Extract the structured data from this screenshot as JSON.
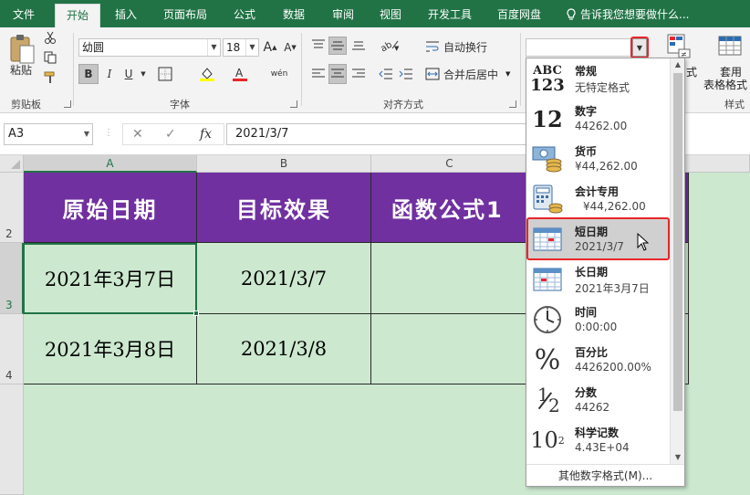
{
  "tabs": [
    "文件",
    "开始",
    "插入",
    "页面布局",
    "公式",
    "数据",
    "审阅",
    "视图",
    "开发工具",
    "百度网盘"
  ],
  "active_tab": "开始",
  "tell_me": "告诉我您想要做什么...",
  "clipboard": {
    "paste": "粘贴",
    "group": "剪贴板"
  },
  "font": {
    "name": "幼圆",
    "size": "18",
    "group": "字体",
    "grow": "A",
    "shrink": "A",
    "bold": "B",
    "italic": "I",
    "underline": "U",
    "phonetic": "wén"
  },
  "alignment": {
    "wrap": "自动换行",
    "merge": "合并后居中",
    "group": "对齐方式"
  },
  "number": {
    "format_value": "",
    "fmt_partial": "式"
  },
  "styles": {
    "table_format": "套用\n表格格式",
    "table_format_l1": "套用",
    "table_format_l2": "表格格式",
    "group_partial": "样式"
  },
  "formula_bar": {
    "name_box": "A3",
    "cancel": "✕",
    "enter": "✓",
    "fx": "fx",
    "value": "2021/3/7"
  },
  "columns": [
    "A",
    "B",
    "C"
  ],
  "rows": [
    "2",
    "3",
    "4"
  ],
  "grid": {
    "headers": [
      "原始日期",
      "目标效果",
      "函数公式1"
    ],
    "rows": [
      [
        "2021年3月7日",
        "2021/3/7",
        ""
      ],
      [
        "2021年3月8日",
        "2021/3/8",
        ""
      ]
    ]
  },
  "dropdown": {
    "items": [
      {
        "name": "常规",
        "sample": "无特定格式",
        "icon": "general-format-icon",
        "icon_text_top": "ABC",
        "icon_text_bottom": "123"
      },
      {
        "name": "数字",
        "sample": "44262.00",
        "icon": "number-format-icon",
        "icon_text": "12"
      },
      {
        "name": "货币",
        "sample": "¥44,262.00",
        "icon": "currency-icon"
      },
      {
        "name": "会计专用",
        "sample": "¥44,262.00",
        "icon": "accounting-icon"
      },
      {
        "name": "短日期",
        "sample": "2021/3/7",
        "icon": "short-date-icon"
      },
      {
        "name": "长日期",
        "sample": "2021年3月7日",
        "icon": "long-date-icon"
      },
      {
        "name": "时间",
        "sample": "0:00:00",
        "icon": "clock-icon"
      },
      {
        "name": "百分比",
        "sample": "4426200.00%",
        "icon": "percent-icon",
        "icon_text": "%"
      },
      {
        "name": "分数",
        "sample": "44262",
        "icon": "fraction-icon",
        "icon_text_top": "1",
        "icon_text_bottom": "2"
      },
      {
        "name": "科学记数",
        "sample": "4.43E+04",
        "icon": "scientific-icon",
        "icon_text": "10",
        "icon_text_sup": "2"
      }
    ],
    "more": "其他数字格式(M)..."
  },
  "colors": {
    "ribbon_green": "#217346",
    "header_purple": "#7030a0",
    "sheet_green": "#cce8cf",
    "highlight_red": "#e8262a"
  }
}
